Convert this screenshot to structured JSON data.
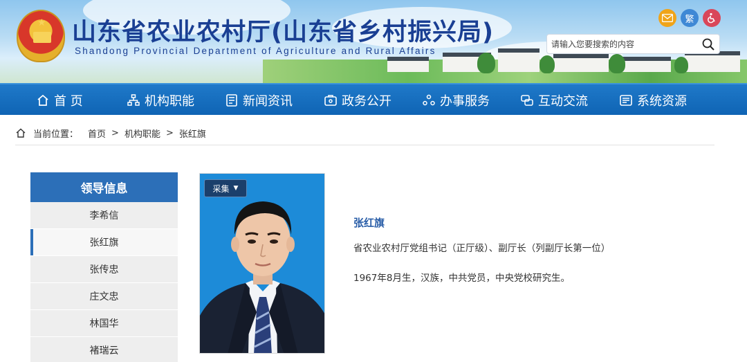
{
  "header": {
    "title": "山东省农业农村厅(山东省乡村振兴局)",
    "subtitle": "Shandong Provincial Department of Agriculture and Rural Affairs",
    "traditional_label": "繁",
    "search_placeholder": "请输入您要搜索的内容",
    "icons": [
      "mail-icon",
      "traditional-chinese-icon",
      "accessibility-icon",
      "search-icon"
    ]
  },
  "nav": {
    "items": [
      {
        "label": "首 页",
        "icon": "home-icon"
      },
      {
        "label": "机构职能",
        "icon": "org-chart-icon"
      },
      {
        "label": "新闻资讯",
        "icon": "news-icon"
      },
      {
        "label": "政务公开",
        "icon": "open-affairs-icon"
      },
      {
        "label": "办事服务",
        "icon": "service-icon"
      },
      {
        "label": "互动交流",
        "icon": "interaction-icon"
      },
      {
        "label": "系统资源",
        "icon": "system-resource-icon"
      }
    ]
  },
  "breadcrumb": {
    "prefix": "当前位置：",
    "items": [
      "首页",
      "机构职能",
      "张红旗"
    ],
    "separator": ">"
  },
  "sidebar": {
    "heading": "领导信息",
    "items": [
      {
        "label": "李希信"
      },
      {
        "label": "张红旗",
        "active": true
      },
      {
        "label": "张传忠"
      },
      {
        "label": "庄文忠"
      },
      {
        "label": "林国华"
      },
      {
        "label": "褚瑞云"
      }
    ]
  },
  "profile": {
    "collect_label": "采集",
    "name": "张红旗",
    "title": "省农业农村厅党组书记（正厅级）、副厅长（列副厅长第一位）",
    "bio": "1967年8月生，汉族，中共党员，中央党校研究生。"
  },
  "colors": {
    "nav_bg": "#0f64b4",
    "title_blue": "#1a3f93",
    "sidebar_head": "#2c6fb8",
    "name_blue": "#2a5ea8"
  }
}
